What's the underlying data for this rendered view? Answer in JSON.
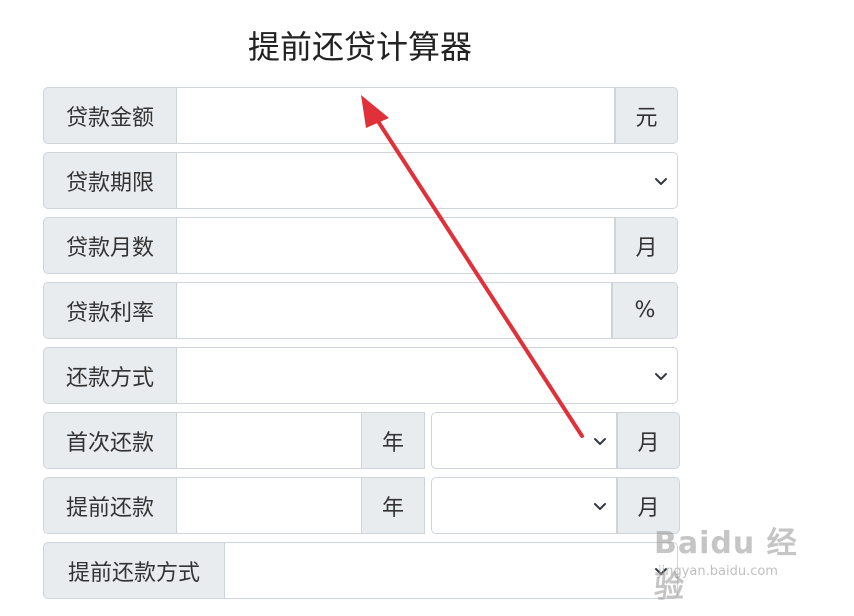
{
  "title": "提前还贷计算器",
  "rows": [
    {
      "label": "贷款金额",
      "unit": "元",
      "value": ""
    },
    {
      "label": "贷款期限",
      "selected": ""
    },
    {
      "label": "贷款月数",
      "unit": "月",
      "value": ""
    },
    {
      "label": "贷款利率",
      "unit": "%",
      "value": ""
    },
    {
      "label": "还款方式",
      "selected": ""
    },
    {
      "label": "首次还款",
      "year_unit": "年",
      "month_unit": "月",
      "year_value": "",
      "month_selected": ""
    },
    {
      "label": "提前还款",
      "year_unit": "年",
      "month_unit": "月",
      "year_value": "",
      "month_selected": ""
    },
    {
      "label": "提前还款方式",
      "selected": ""
    }
  ],
  "watermark": {
    "brand": "Baidu 经验",
    "url": "jingyan.baidu.com"
  },
  "colors": {
    "addon_bg": "#e9ecef",
    "border": "#ced4da",
    "arrow": "#e0313a"
  },
  "icons": {
    "dropdown": "chevron-down-icon",
    "annotation": "red-arrow"
  }
}
